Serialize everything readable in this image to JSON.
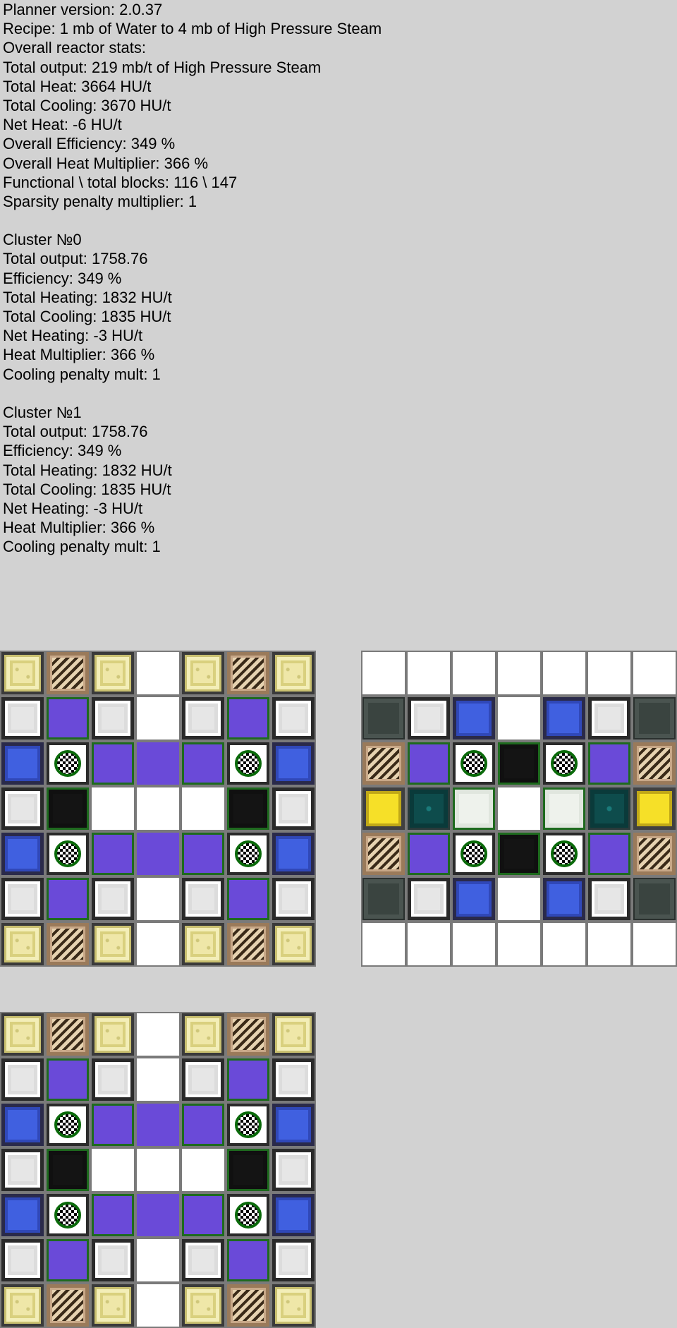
{
  "stats": [
    "Planner version: 2.0.37",
    "Recipe: 1 mb of Water to 4 mb of High Pressure Steam",
    "Overall reactor stats:",
    "Total output: 219 mb/t of High Pressure Steam",
    "Total Heat: 3664 HU/t",
    "Total Cooling: 3670 HU/t",
    "Net Heat: -6 HU/t",
    "Overall Efficiency: 349 %",
    "Overall Heat Multiplier: 366 %",
    "Functional \\ total blocks: 116 \\ 147",
    "Sparsity penalty multiplier: 1",
    "",
    "Cluster №0",
    "Total output: 1758.76",
    "Efficiency: 349 %",
    "Total Heating: 1832 HU/t",
    "Total Cooling: 1835 HU/t",
    "Net Heating: -3 HU/t",
    "Heat Multiplier: 366 %",
    "Cooling penalty mult: 1",
    "",
    "Cluster №1",
    "Total output: 1758.76",
    "Efficiency: 349 %",
    "Total Heating: 1832 HU/t",
    "Total Cooling: 1835 HU/t",
    "Net Heating: -3 HU/t",
    "Heat Multiplier: 366 %",
    "Cooling penalty mult: 1"
  ],
  "layers": [
    {
      "rows": [
        [
          "glow",
          "stripe",
          "glow",
          "empty",
          "glow",
          "stripe",
          "glow"
        ],
        [
          "light",
          "purple",
          "light",
          "empty",
          "light",
          "purple",
          "light"
        ],
        [
          "blue",
          "check",
          "purple",
          "purple2",
          "purple",
          "check",
          "blue"
        ],
        [
          "light",
          "black",
          "empty",
          "empty",
          "empty",
          "black",
          "light"
        ],
        [
          "blue",
          "check",
          "purple",
          "purple2",
          "purple",
          "check",
          "blue"
        ],
        [
          "light",
          "purple",
          "light",
          "empty",
          "light",
          "purple",
          "light"
        ],
        [
          "glow",
          "stripe",
          "glow",
          "empty",
          "glow",
          "stripe",
          "glow"
        ]
      ]
    },
    {
      "rows": [
        [
          "empty",
          "empty",
          "empty",
          "empty",
          "empty",
          "empty",
          "empty"
        ],
        [
          "dark",
          "light",
          "blue",
          "empty",
          "blue",
          "light",
          "dark"
        ],
        [
          "stripe",
          "purple",
          "check",
          "black",
          "check",
          "purple",
          "stripe"
        ],
        [
          "yellow",
          "teal",
          "pale",
          "empty",
          "pale",
          "teal",
          "yellow"
        ],
        [
          "stripe",
          "purple",
          "check",
          "black",
          "check",
          "purple",
          "stripe"
        ],
        [
          "dark",
          "light",
          "blue",
          "empty",
          "blue",
          "light",
          "dark"
        ],
        [
          "empty",
          "empty",
          "empty",
          "empty",
          "empty",
          "empty",
          "empty"
        ]
      ]
    },
    {
      "rows": [
        [
          "glow",
          "stripe",
          "glow",
          "empty",
          "glow",
          "stripe",
          "glow"
        ],
        [
          "light",
          "purple",
          "light",
          "empty",
          "light",
          "purple",
          "light"
        ],
        [
          "blue",
          "check",
          "purple",
          "purple2",
          "purple",
          "check",
          "blue"
        ],
        [
          "light",
          "black",
          "empty",
          "empty",
          "empty",
          "black",
          "light"
        ],
        [
          "blue",
          "check",
          "purple",
          "purple2",
          "purple",
          "check",
          "blue"
        ],
        [
          "light",
          "purple",
          "light",
          "empty",
          "light",
          "purple",
          "light"
        ],
        [
          "glow",
          "stripe",
          "glow",
          "empty",
          "glow",
          "stripe",
          "glow"
        ]
      ]
    }
  ]
}
